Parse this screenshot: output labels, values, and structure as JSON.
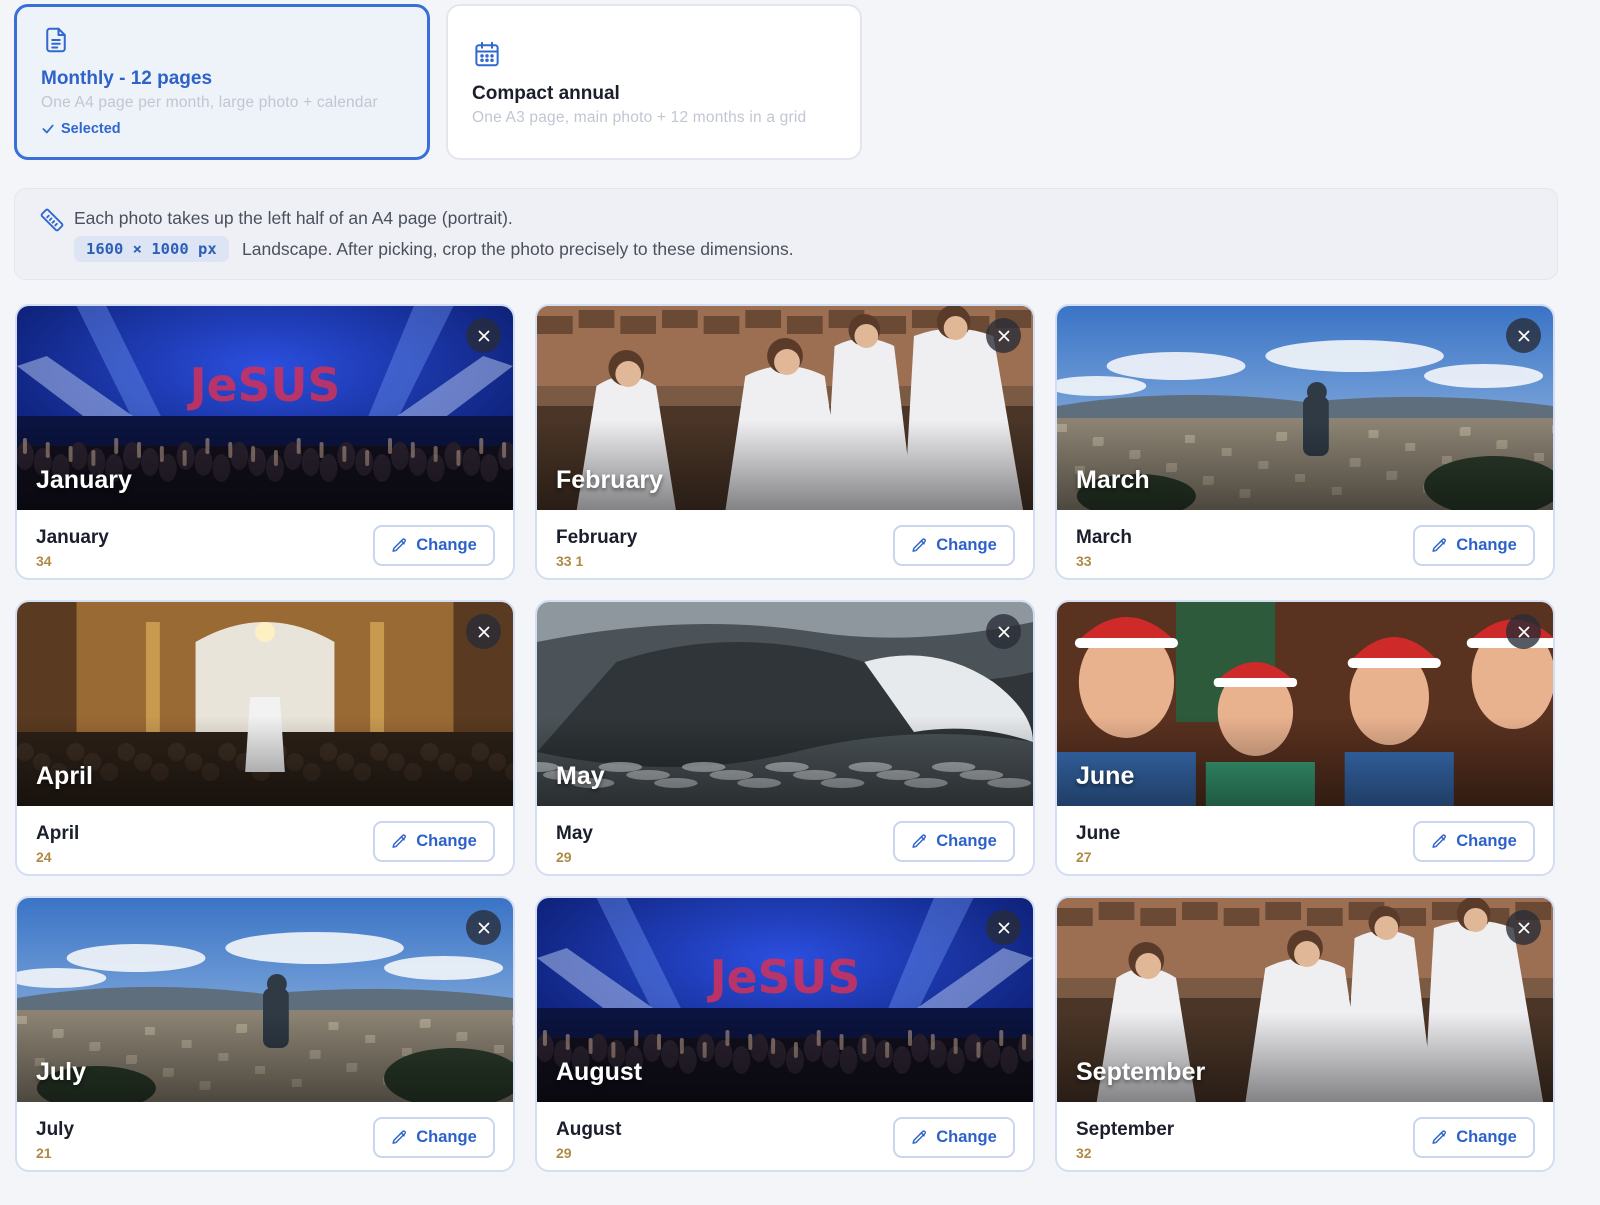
{
  "layout_options": [
    {
      "title": "Monthly - 12 pages",
      "description": "One A4 page per month, large photo + calendar",
      "selected_label": "Selected",
      "icon": "document-icon",
      "selected": true
    },
    {
      "title": "Compact annual",
      "description": "One A3 page, main photo + 12 months in a grid",
      "icon": "calendar-icon",
      "selected": false
    }
  ],
  "info": {
    "line1": "Each photo takes up the left half of an A4 page (portrait).",
    "dimensions": "1600 × 1000 px",
    "line2": "Landscape. After picking, crop the photo precisely to these dimensions.",
    "icon": "ruler-icon"
  },
  "months": [
    {
      "overlay": "January",
      "name": "January",
      "count": "34",
      "change_label": "Change",
      "scene": "concert"
    },
    {
      "overlay": "February",
      "name": "February",
      "count": "33  1",
      "change_label": "Change",
      "scene": "procession"
    },
    {
      "overlay": "March",
      "name": "March",
      "count": "33",
      "change_label": "Change",
      "scene": "city"
    },
    {
      "overlay": "April",
      "name": "April",
      "count": "24",
      "change_label": "Change",
      "scene": "church"
    },
    {
      "overlay": "May",
      "name": "May",
      "count": "29",
      "change_label": "Change",
      "scene": "wave"
    },
    {
      "overlay": "June",
      "name": "June",
      "count": "27",
      "change_label": "Change",
      "scene": "christmas"
    },
    {
      "overlay": "July",
      "name": "July",
      "count": "21",
      "change_label": "Change",
      "scene": "city"
    },
    {
      "overlay": "August",
      "name": "August",
      "count": "29",
      "change_label": "Change",
      "scene": "concert"
    },
    {
      "overlay": "September",
      "name": "September",
      "count": "32",
      "change_label": "Change",
      "scene": "procession"
    }
  ],
  "colors": {
    "accent": "#3a6fd8",
    "count": "#b08a45",
    "badge_bg": "#dde5f4"
  }
}
